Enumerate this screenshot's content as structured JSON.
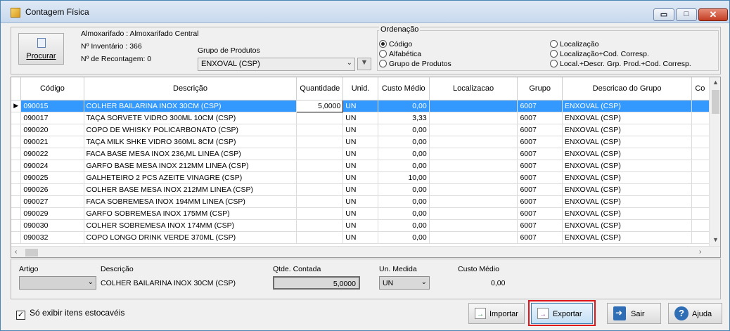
{
  "window": {
    "title": "Contagem Física",
    "min_glyph": "▭",
    "max_glyph": "□",
    "close_glyph": "✕"
  },
  "header": {
    "procurar_label": "Procurar",
    "almoxarifado": "Almoxarifado : Almoxarifado Central",
    "inventario": "Nº Inventário : 366",
    "recontagem": "Nº de Recontagem: 0",
    "grupo_label": "Grupo de Produtos",
    "grupo_value": "ENXOVAL (CSP)"
  },
  "ordenacao": {
    "title": "Ordenação",
    "options": [
      {
        "label": "Código",
        "selected": true
      },
      {
        "label": "Alfabética",
        "selected": false
      },
      {
        "label": "Grupo de Produtos",
        "selected": false
      },
      {
        "label": "Localização",
        "selected": false
      },
      {
        "label": "Localização+Cod. Corresp.",
        "selected": false
      },
      {
        "label": "Local.+Descr. Grp. Prod.+Cod. Corresp.",
        "selected": false
      }
    ]
  },
  "grid": {
    "columns": [
      "Código",
      "Descrição",
      "Quantidade",
      "Unid.",
      "Custo Médio",
      "Localizacao",
      "Grupo",
      "Descricao do Grupo",
      "Co"
    ],
    "selected_marker": "▶",
    "rows": [
      [
        "090015",
        "COLHER BAILARINA INOX 30CM (CSP)",
        "5,0000",
        "UN",
        "0,00",
        "",
        "6007",
        "ENXOVAL (CSP)",
        ""
      ],
      [
        "090017",
        "TAÇA SORVETE VIDRO 300ML 10CM (CSP)",
        "",
        "UN",
        "3,33",
        "",
        "6007",
        "ENXOVAL (CSP)",
        ""
      ],
      [
        "090020",
        "COPO DE WHISKY POLICARBONATO (CSP)",
        "",
        "UN",
        "0,00",
        "",
        "6007",
        "ENXOVAL (CSP)",
        ""
      ],
      [
        "090021",
        "TAÇA MILK SHKE VIDRO 360ML 8CM (CSP)",
        "",
        "UN",
        "0,00",
        "",
        "6007",
        "ENXOVAL (CSP)",
        ""
      ],
      [
        "090022",
        "FACA BASE MESA INOX 236,ML LINEA (CSP)",
        "",
        "UN",
        "0,00",
        "",
        "6007",
        "ENXOVAL (CSP)",
        ""
      ],
      [
        "090024",
        "GARFO BASE MESA INOX 212MM LINEA (CSP)",
        "",
        "UN",
        "0,00",
        "",
        "6007",
        "ENXOVAL (CSP)",
        ""
      ],
      [
        "090025",
        "GALHETEIRO 2 PCS AZEITE VINAGRE (CSP)",
        "",
        "UN",
        "10,00",
        "",
        "6007",
        "ENXOVAL (CSP)",
        ""
      ],
      [
        "090026",
        "COLHER BASE MESA INOX 212MM LINEA (CSP)",
        "",
        "UN",
        "0,00",
        "",
        "6007",
        "ENXOVAL (CSP)",
        ""
      ],
      [
        "090027",
        "FACA SOBREMESA INOX 194MM LINEA (CSP)",
        "",
        "UN",
        "0,00",
        "",
        "6007",
        "ENXOVAL (CSP)",
        ""
      ],
      [
        "090029",
        "GARFO SOBREMESA INOX 175MM (CSP)",
        "",
        "UN",
        "0,00",
        "",
        "6007",
        "ENXOVAL (CSP)",
        ""
      ],
      [
        "090030",
        "COLHER SOBREMESA INOX 174MM (CSP)",
        "",
        "UN",
        "0,00",
        "",
        "6007",
        "ENXOVAL (CSP)",
        ""
      ],
      [
        "090032",
        "COPO LONGO DRINK VERDE 370ML (CSP)",
        "",
        "UN",
        "0,00",
        "",
        "6007",
        "ENXOVAL (CSP)",
        ""
      ]
    ]
  },
  "detail": {
    "artigo_label": "Artigo",
    "artigo_value": "",
    "descricao_label": "Descrição",
    "descricao_value": "COLHER BAILARINA INOX 30CM (CSP)",
    "qtde_label": "Qtde. Contada",
    "qtde_value": "5,0000",
    "unidade_label": "Un. Medida",
    "unidade_value": "UN",
    "custo_label": "Custo Médio",
    "custo_value": "0,00"
  },
  "footer": {
    "checkbox_label": "Só exibir itens estocavéis",
    "checkbox_checked": true,
    "check_glyph": "✓",
    "importar": "Importar",
    "exportar": "Exportar",
    "sair": "Sair",
    "ajuda": "Ajuda"
  },
  "colors": {
    "selection": "#3399ff",
    "highlight_ring": "#e0161b"
  }
}
